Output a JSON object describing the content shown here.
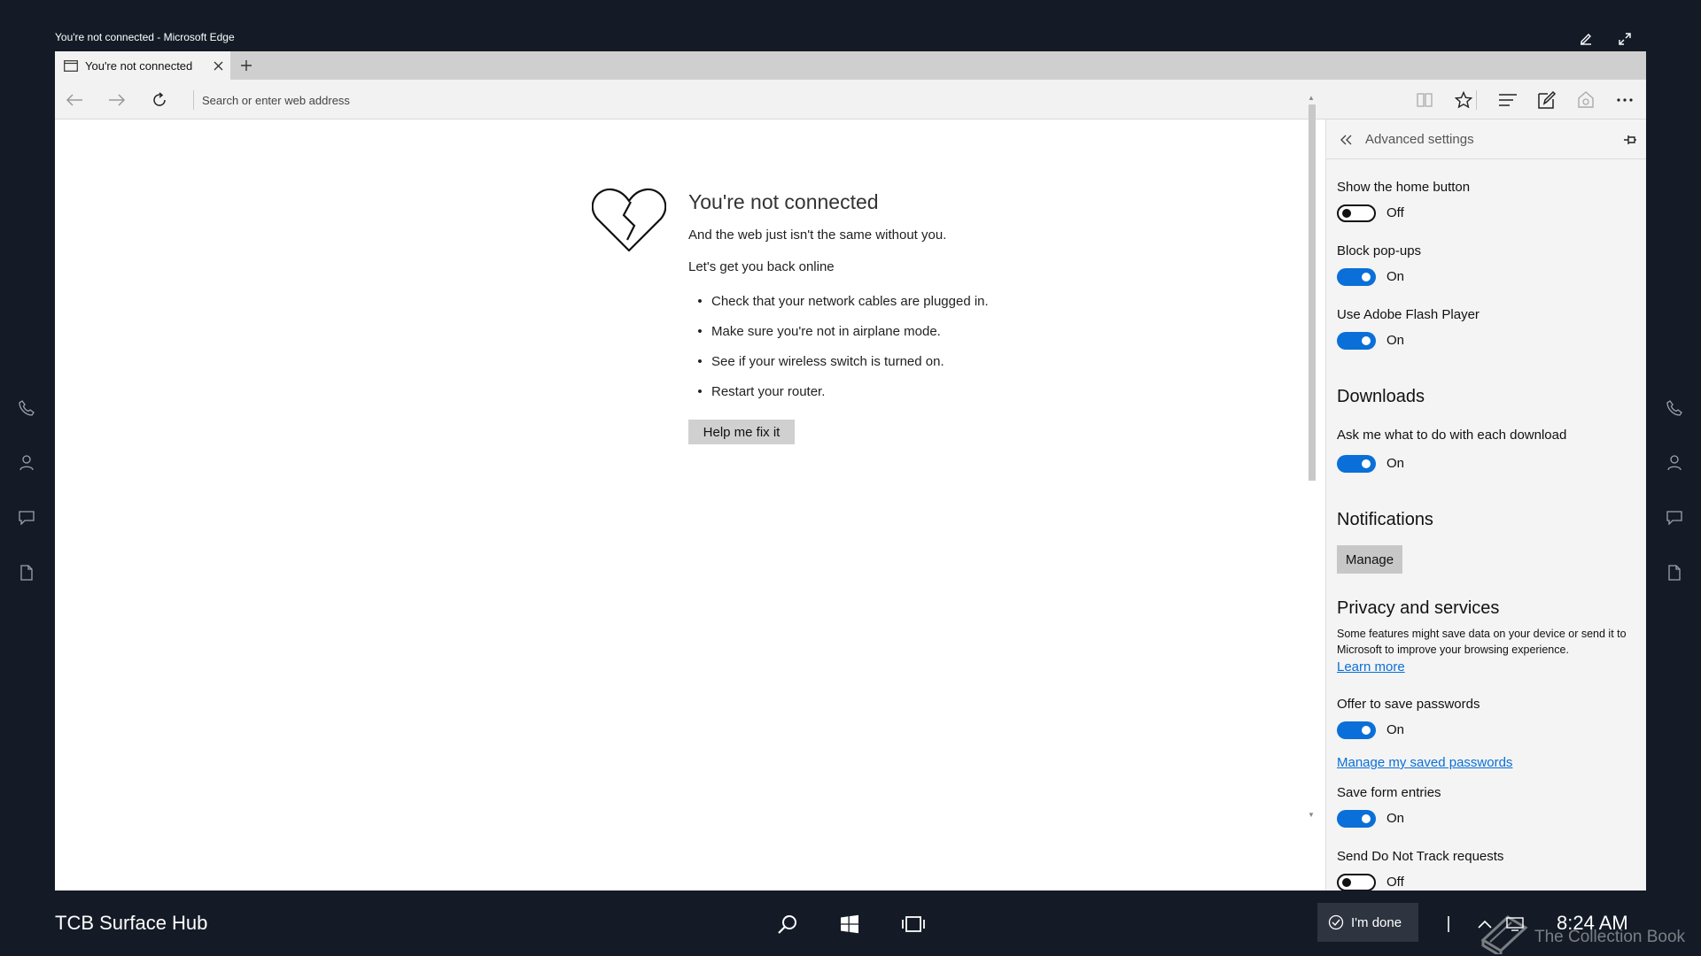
{
  "window": {
    "title": "You're not connected - Microsoft Edge"
  },
  "tab": {
    "title": "You're not connected"
  },
  "address_bar": {
    "placeholder": "Search or enter web address"
  },
  "error_page": {
    "title": "You're not connected",
    "subtitle": "And the web just isn't the same without you.",
    "back_online": "Let's get you back online",
    "tips": [
      "Check that your network cables are plugged in.",
      "Make sure you're not in airplane mode.",
      "See if your wireless switch is turned on.",
      "Restart your router."
    ],
    "fix_button": "Help me fix it"
  },
  "settings_pane": {
    "title": "Advanced settings",
    "home_button": {
      "label": "Show the home button",
      "state": "Off"
    },
    "block_popups": {
      "label": "Block pop-ups",
      "state": "On"
    },
    "flash_player": {
      "label": "Use Adobe Flash Player",
      "state": "On"
    },
    "downloads": {
      "title": "Downloads",
      "ask": {
        "label": "Ask me what to do with each download",
        "state": "On"
      }
    },
    "notifications": {
      "title": "Notifications",
      "manage": "Manage"
    },
    "privacy": {
      "title": "Privacy and services",
      "description": "Some features might save data on your device or send it to Microsoft to improve your browsing experience.",
      "learn_more": "Learn more",
      "save_passwords": {
        "label": "Offer to save passwords",
        "state": "On"
      },
      "manage_passwords": "Manage my saved passwords",
      "form_entries": {
        "label": "Save form entries",
        "state": "On"
      },
      "do_not_track": {
        "label": "Send Do Not Track requests",
        "state": "Off"
      }
    }
  },
  "taskbar": {
    "device_name": "TCB Surface Hub",
    "done_button": "I'm done",
    "clock": "8:24 AM",
    "watermark": "The Collection Book"
  },
  "colors": {
    "background": "#141b26",
    "accent": "#0a6fd8",
    "pane_background": "#f4f4f4"
  }
}
